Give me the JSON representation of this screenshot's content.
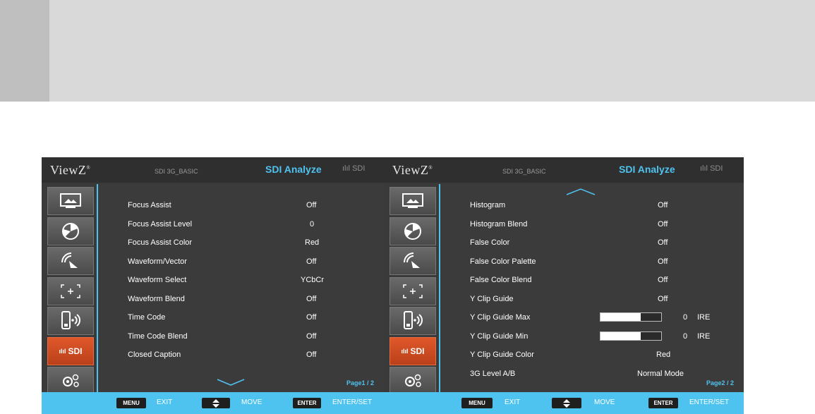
{
  "brand": "ViewZ",
  "source_label": "SDI 3G_BASIC",
  "menu_title": "SDI Analyze",
  "input_tag": "SDI",
  "sidebar_active_label": "SDI",
  "footer": {
    "menu_key": "MENU",
    "exit": "EXIT",
    "move": "MOVE",
    "enter_key": "ENTER",
    "enter_set": "ENTER/SET"
  },
  "page1": {
    "page_label": "Page1 / 2",
    "rows": [
      {
        "label": "Focus Assist",
        "value": "Off"
      },
      {
        "label": "Focus Assist Level",
        "value": "0"
      },
      {
        "label": "Focus Assist Color",
        "value": "Red"
      },
      {
        "label": "Waveform/Vector",
        "value": "Off"
      },
      {
        "label": "Waveform Select",
        "value": "YCbCr"
      },
      {
        "label": "Waveform Blend",
        "value": "Off"
      },
      {
        "label": "Time Code",
        "value": "Off"
      },
      {
        "label": "Time Code Blend",
        "value": "Off"
      },
      {
        "label": "Closed Caption",
        "value": "Off"
      }
    ]
  },
  "page2": {
    "page_label": "Page2 / 2",
    "rows": [
      {
        "label": "Histogram",
        "value": "Off"
      },
      {
        "label": "Histogram Blend",
        "value": "Off"
      },
      {
        "label": "False Color",
        "value": "Off"
      },
      {
        "label": "False Color Palette",
        "value": "Off"
      },
      {
        "label": "False Color Blend",
        "value": "Off"
      },
      {
        "label": "Y Clip Guide",
        "value": "Off"
      },
      {
        "label": "Y Clip Guide Max",
        "value": "0",
        "unit": "IRE",
        "bar_fill": 0.66
      },
      {
        "label": "Y Clip Guide Min",
        "value": "0",
        "unit": "IRE",
        "bar_fill": 0.66
      },
      {
        "label": "Y Clip Guide Color",
        "value": "Red"
      },
      {
        "label": "3G Level A/B",
        "value": "Normal Mode"
      }
    ]
  },
  "colors": {
    "accent": "#4fc3ef",
    "active": "#d94f22",
    "bg": "#3a3a3a"
  }
}
